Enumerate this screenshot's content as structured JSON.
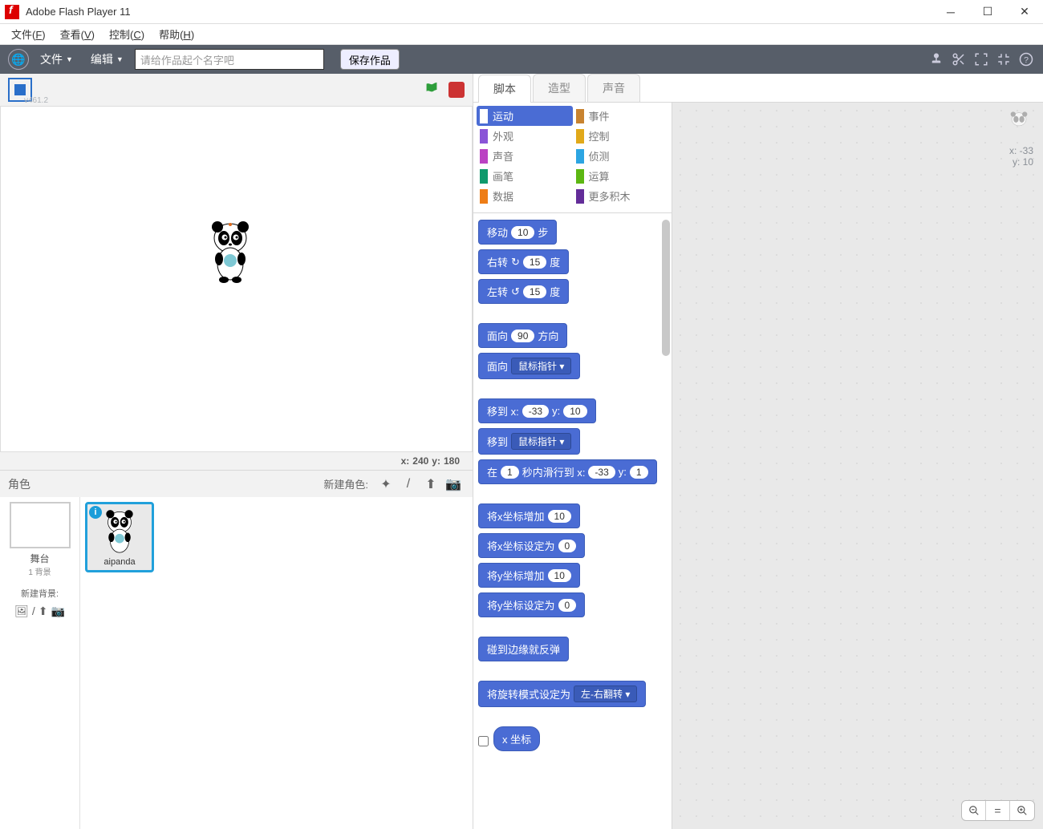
{
  "window": {
    "title": "Adobe Flash Player 11"
  },
  "osmenu": {
    "file": "文件(F)",
    "view": "查看(V)",
    "control": "控制(C)",
    "help": "帮助(H)"
  },
  "toolbar": {
    "file": "文件",
    "edit": "编辑",
    "name_placeholder": "请给作品起个名字吧",
    "save": "保存作品"
  },
  "stage": {
    "version": "v461.2",
    "coords_x_label": "x:",
    "coords_x_value": "240",
    "coords_y_label": "y:",
    "coords_y_value": "180"
  },
  "spritebar": {
    "label": "角色",
    "new_label": "新建角色:"
  },
  "stagecol": {
    "label": "舞台",
    "sub": "1 背景",
    "newbg": "新建背景:"
  },
  "sprite": {
    "name": "aipanda"
  },
  "tabs": {
    "scripts": "脚本",
    "costumes": "造型",
    "sounds": "声音"
  },
  "categories": {
    "motion": "运动",
    "looks": "外观",
    "sound": "声音",
    "pen": "画笔",
    "data": "数据",
    "events": "事件",
    "control": "控制",
    "sensing": "侦测",
    "operators": "运算",
    "more": "更多积木"
  },
  "blocks": {
    "move_a": "移动",
    "move_steps": "10",
    "move_b": "步",
    "turnr_a": "右转",
    "turnr_deg": "15",
    "turnr_b": "度",
    "turnl_a": "左转",
    "turnl_deg": "15",
    "turnl_b": "度",
    "point_dir_a": "面向",
    "point_dir_val": "90",
    "point_dir_b": "方向",
    "point_towards_a": "面向",
    "point_towards_val": "鼠标指针",
    "goto_xy_a": "移到 x:",
    "goto_x": "-33",
    "goto_xy_b": "y:",
    "goto_y": "10",
    "goto_a": "移到",
    "goto_val": "鼠标指针",
    "glide_a": "在",
    "glide_secs": "1",
    "glide_b": "秒内滑行到 x:",
    "glide_x": "-33",
    "glide_c": "y:",
    "glide_y": "1",
    "changex_a": "将x坐标增加",
    "changex_v": "10",
    "setx_a": "将x坐标设定为",
    "setx_v": "0",
    "changey_a": "将y坐标增加",
    "changey_v": "10",
    "sety_a": "将y坐标设定为",
    "sety_v": "0",
    "bounce": "碰到边缘就反弹",
    "rotstyle_a": "将旋转模式设定为",
    "rotstyle_v": "左-右翻转",
    "xpos": "x 坐标"
  },
  "script_info": {
    "x_label": "x:",
    "x_val": "-33",
    "y_label": "y:",
    "y_val": "10"
  }
}
